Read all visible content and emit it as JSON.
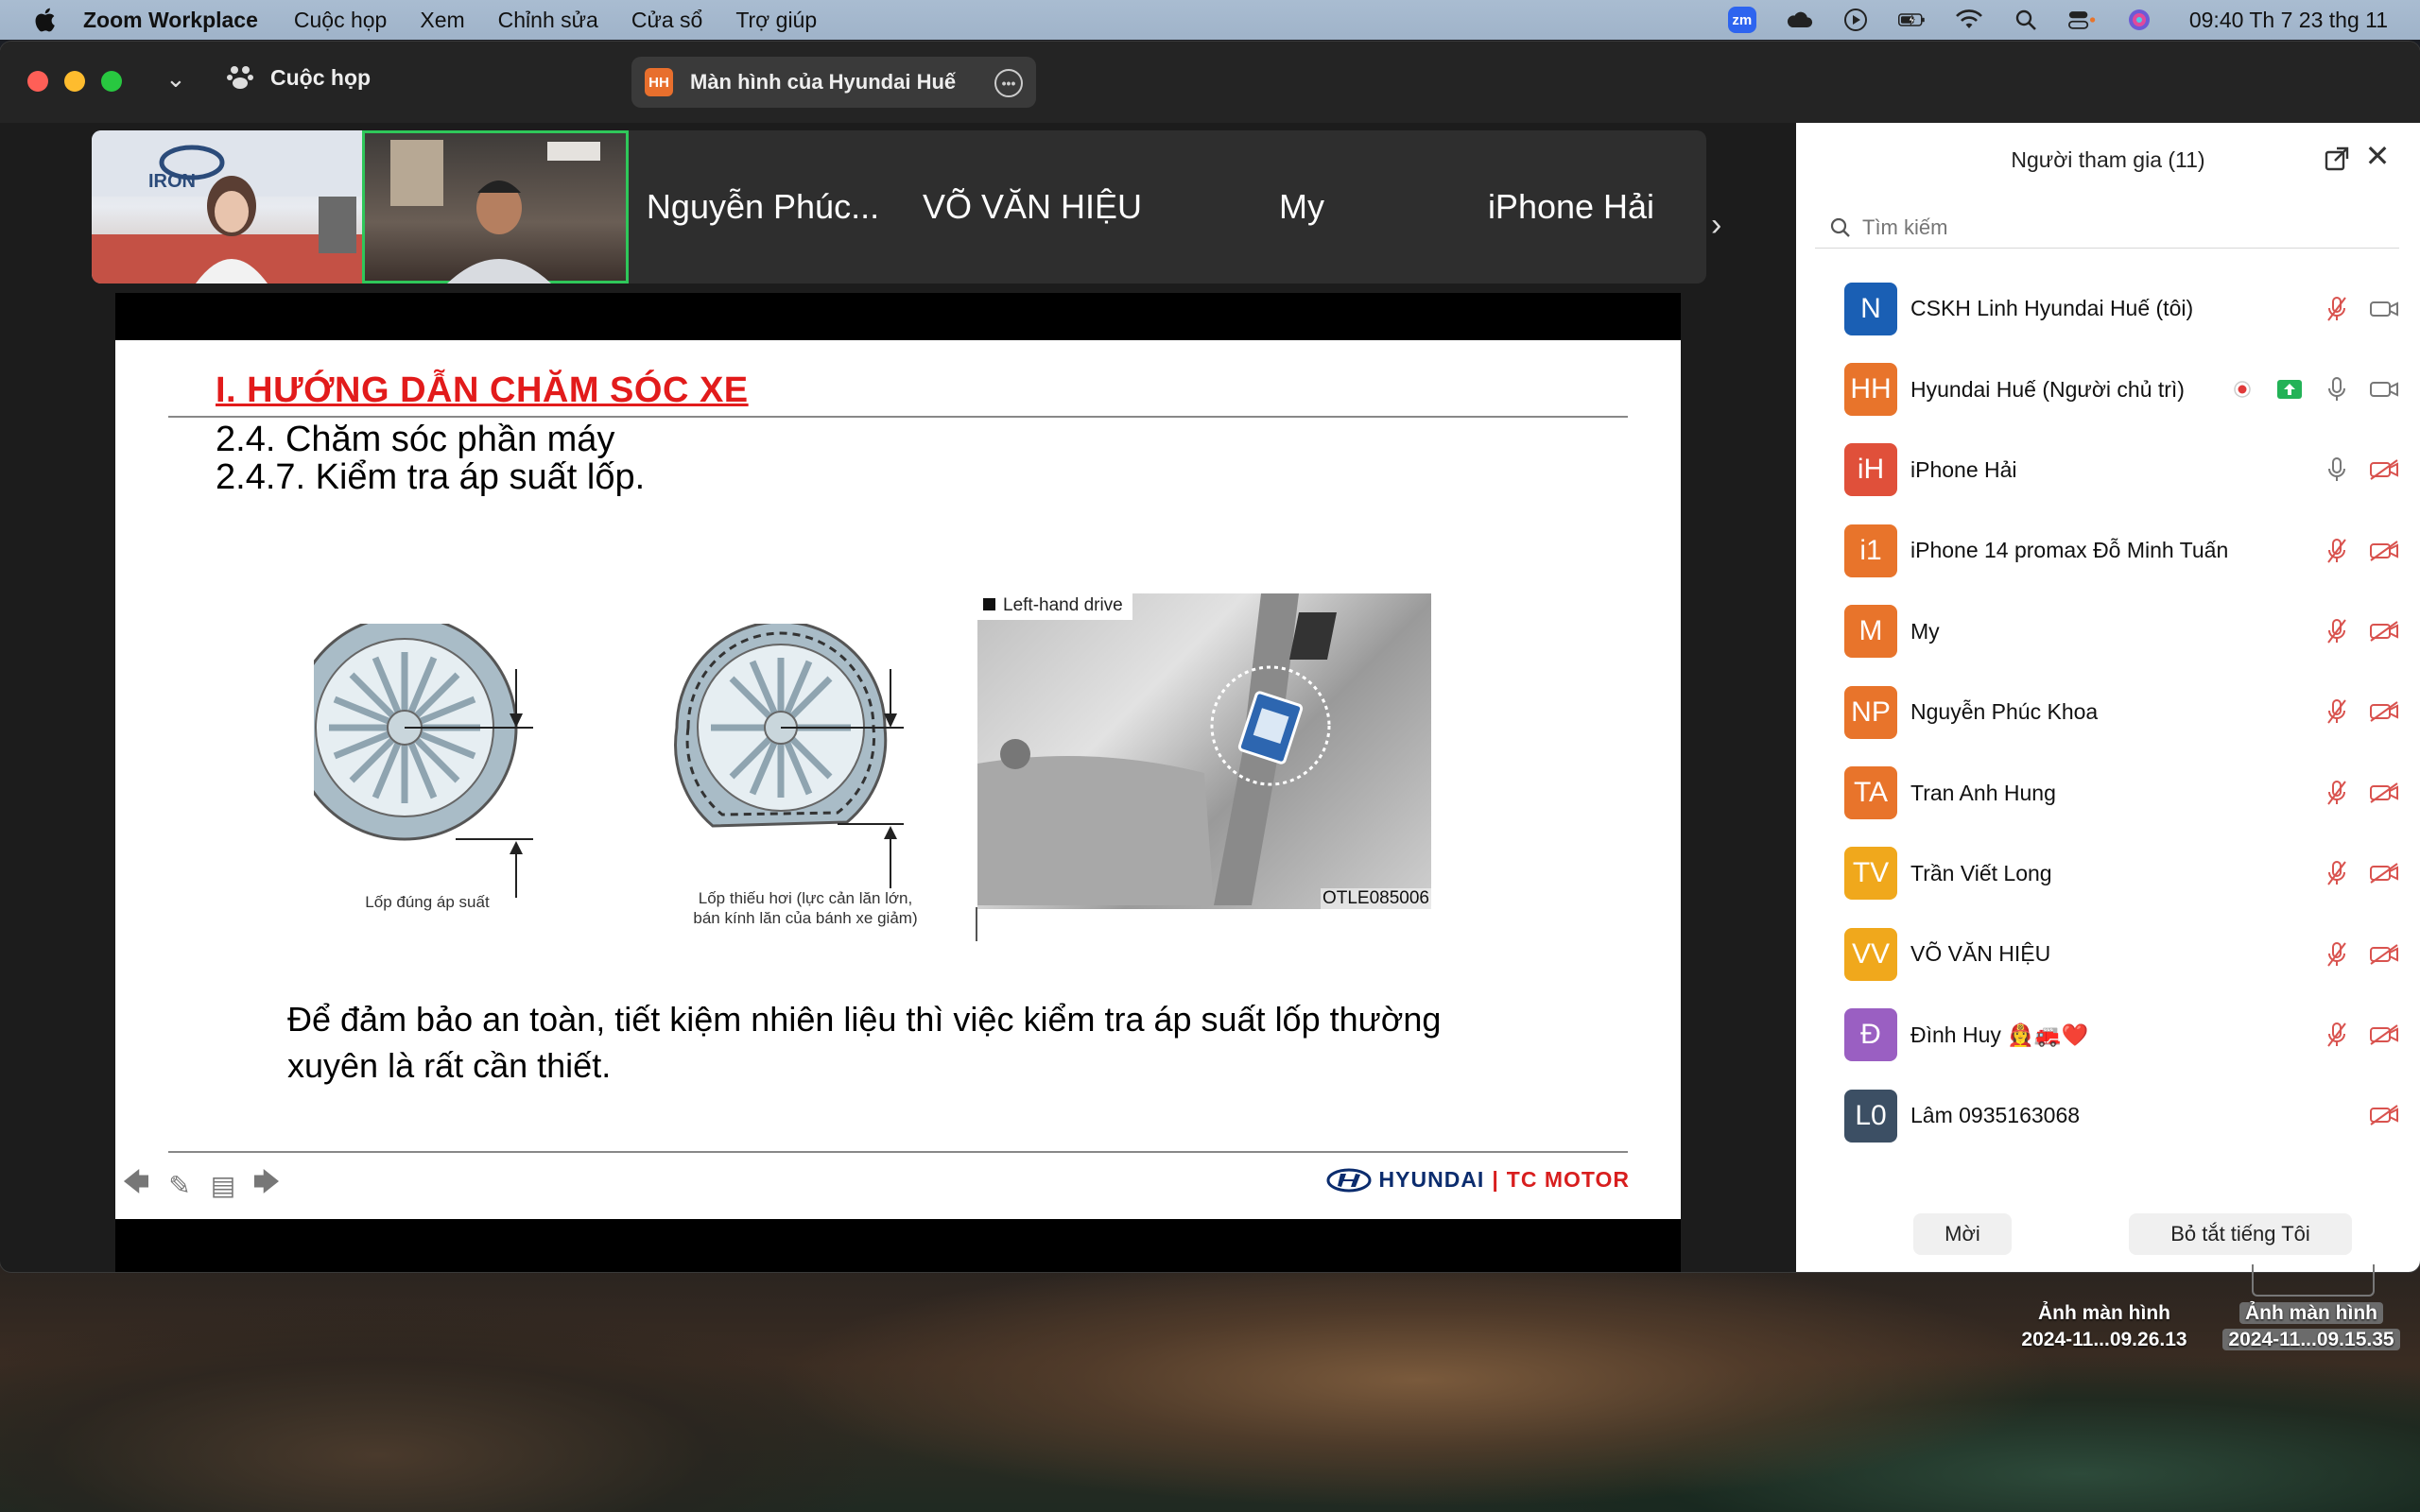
{
  "menubar": {
    "app": "Zoom Workplace",
    "items": [
      "Cuộc họp",
      "Xem",
      "Chỉnh sửa",
      "Cửa sổ",
      "Trợ giúp"
    ],
    "zm": "zm",
    "clock": "09:40 Th 7 23 thg 11"
  },
  "window": {
    "meeting_label": "Cuộc họp",
    "share_badge": "HH",
    "share_label": "Màn hình của Hyundai Huế"
  },
  "strip": {
    "names": [
      "Nguyễn Phúc...",
      "VÕ VĂN HIỆU",
      "My",
      "iPhone Hải"
    ]
  },
  "slide": {
    "title": "I. HƯỚNG DẪN CHĂM SÓC XE",
    "sub1": "2.4. Chăm sóc phần máy",
    "sub2": "2.4.7. Kiểm tra áp suất lốp.",
    "tire1_caption": "Lốp đúng áp suất",
    "tire2_caption_line1": "Lốp thiếu hơi (lực cản lăn lớn,",
    "tire2_caption_line2": "bán kính lăn của bánh xe giảm)",
    "photo_label": "Left-hand drive",
    "photo_code": "OTLE085006",
    "body": "Để đảm bảo an toàn, tiết kiệm nhiên liệu thì việc kiểm tra áp suất lốp thường xuyên là rất cần thiết.",
    "footer_brand": "HYUNDAI",
    "footer_sep": "|",
    "footer_dealer": "TC MOTOR"
  },
  "panel": {
    "title": "Người tham gia (11)",
    "search_placeholder": "Tìm kiếm",
    "participants": [
      {
        "initials": "N",
        "name": "CSKH Linh Hyundai Huế (tôi)",
        "color": "#1a5fb4",
        "mic": "muted",
        "cam": "on"
      },
      {
        "initials": "HH",
        "name": "Hyundai Huế (Người chủ trì)",
        "color": "#e8742b",
        "mic": "on",
        "cam": "on",
        "recording": true,
        "sharing": true
      },
      {
        "initials": "iH",
        "name": "iPhone Hải",
        "color": "#e0503a",
        "mic": "on",
        "cam": "off"
      },
      {
        "initials": "i1",
        "name": "iPhone 14 promax Đỗ Minh Tuấn",
        "color": "#e8742b",
        "mic": "muted",
        "cam": "off"
      },
      {
        "initials": "M",
        "name": "My",
        "color": "#e8742b",
        "mic": "muted",
        "cam": "off"
      },
      {
        "initials": "NP",
        "name": "Nguyễn Phúc Khoa",
        "color": "#e8742b",
        "mic": "muted",
        "cam": "off"
      },
      {
        "initials": "TA",
        "name": "Tran Anh Hung",
        "color": "#e8742b",
        "mic": "muted",
        "cam": "off"
      },
      {
        "initials": "TV",
        "name": "Trần Viết Long",
        "color": "#f0a81c",
        "mic": "muted",
        "cam": "off"
      },
      {
        "initials": "VV",
        "name": "VÕ VĂN HIỆU",
        "color": "#f0a81c",
        "mic": "muted",
        "cam": "off"
      },
      {
        "initials": "Đ",
        "name": "Đình Huy 👩‍🚒🚒❤️",
        "color": "#9a5fc2",
        "mic": "muted",
        "cam": "off"
      },
      {
        "initials": "L0",
        "name": "Lâm 0935163068",
        "color": "#3c4f64",
        "mic": "none",
        "cam": "off"
      }
    ],
    "invite": "Mời",
    "mute_all": "Bỏ tắt tiếng Tôi"
  },
  "desktop": {
    "shot1_line1": "Ảnh màn hình",
    "shot1_line2": "2024-11...09.26.13",
    "shot2_line1": "Ảnh màn hình",
    "shot2_line2": "2024-11...09.15.35"
  }
}
